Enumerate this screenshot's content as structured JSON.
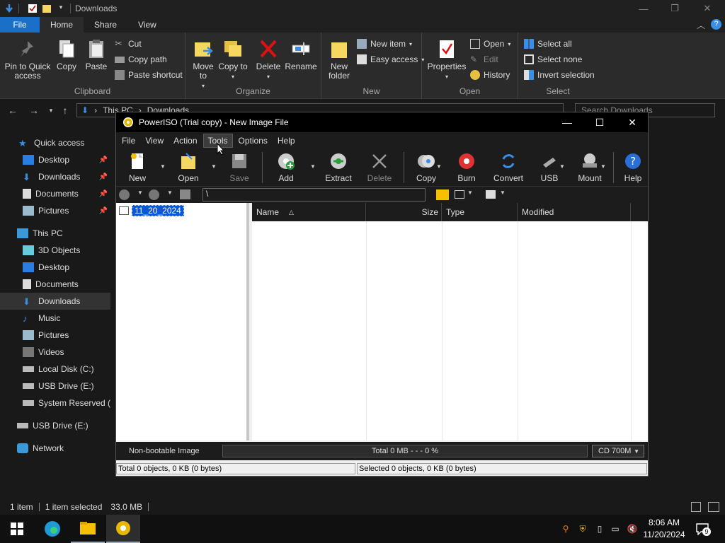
{
  "explorer": {
    "title": "Downloads",
    "tabs": [
      "File",
      "Home",
      "Share",
      "View"
    ],
    "clipboard": {
      "label": "Clipboard",
      "pin": "Pin to Quick access",
      "copy": "Copy",
      "paste": "Paste",
      "cut": "Cut",
      "copy_path": "Copy path",
      "paste_shortcut": "Paste shortcut"
    },
    "organize": {
      "label": "Organize",
      "move_to": "Move to",
      "copy_to": "Copy to",
      "delete": "Delete",
      "rename": "Rename"
    },
    "new": {
      "label": "New",
      "new_folder": "New folder",
      "new_item": "New item",
      "easy_access": "Easy access"
    },
    "open": {
      "label": "Open",
      "properties": "Properties",
      "open": "Open",
      "edit": "Edit",
      "history": "History"
    },
    "select": {
      "label": "Select",
      "select_all": "Select all",
      "select_none": "Select none",
      "invert": "Invert selection"
    },
    "address": {
      "crumb1": "This PC",
      "crumb2": "Downloads",
      "search_placeholder": "Search Downloads"
    },
    "nav": {
      "quick_access": "Quick access",
      "qa_desktop": "Desktop",
      "qa_downloads": "Downloads",
      "qa_documents": "Documents",
      "qa_pictures": "Pictures",
      "this_pc": "This PC",
      "objects3d": "3D Objects",
      "desktop": "Desktop",
      "documents": "Documents",
      "downloads": "Downloads",
      "music": "Music",
      "pictures": "Pictures",
      "videos": "Videos",
      "local_disk": "Local Disk (C:)",
      "usb_drive": "USB Drive (E:)",
      "system_reserved": "System Reserved (M",
      "usb_drive2": "USB Drive (E:)",
      "network": "Network"
    },
    "status": {
      "items": "1 item",
      "selected": "1 item selected",
      "size": "33.0 MB"
    }
  },
  "poweriso": {
    "title": "PowerISO (Trial copy) - New Image File",
    "menu": [
      "File",
      "View",
      "Action",
      "Tools",
      "Options",
      "Help"
    ],
    "toolbar": {
      "new": "New",
      "open": "Open",
      "save": "Save",
      "add": "Add",
      "extract": "Extract",
      "delete": "Delete",
      "copy": "Copy",
      "burn": "Burn",
      "convert": "Convert",
      "usb": "USB",
      "mount": "Mount",
      "help": "Help"
    },
    "path": "\\",
    "tree_node": "11_20_2024",
    "columns": {
      "name": "Name",
      "size": "Size",
      "type": "Type",
      "modified": "Modified"
    },
    "status": {
      "boot": "Non-bootable Image",
      "total": "Total  0 MB   - - -  0 %",
      "media": "CD 700M",
      "total_objects": "Total 0 objects, 0 KB (0 bytes)",
      "selected_objects": "Selected 0 objects, 0 KB (0 bytes)"
    }
  },
  "taskbar": {
    "time": "8:06 AM",
    "date": "11/20/2024",
    "notification_count": "9"
  }
}
